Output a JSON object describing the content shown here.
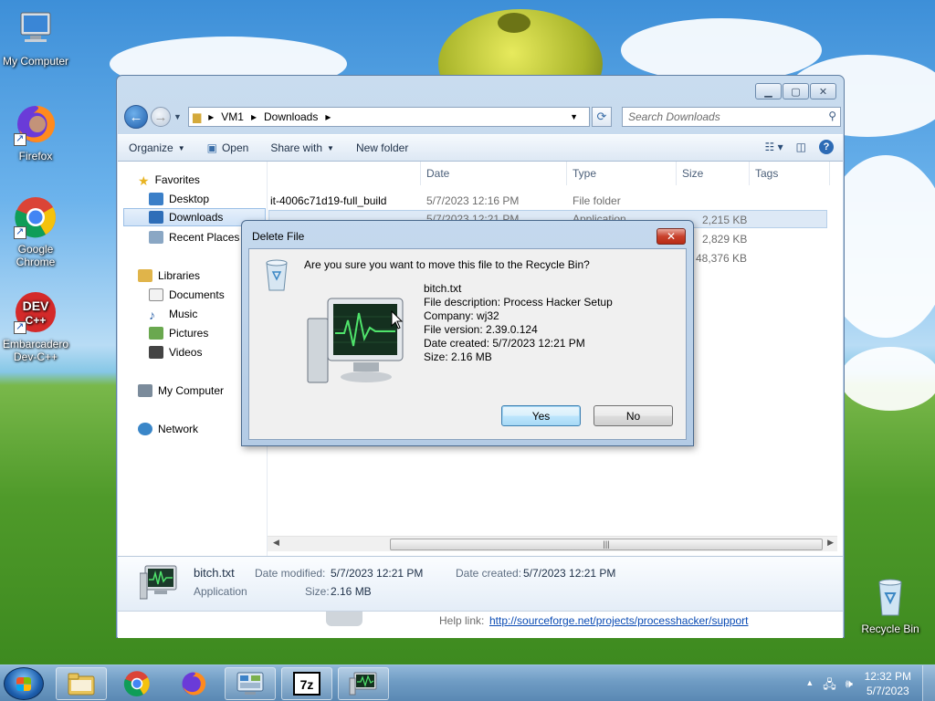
{
  "desktop": {
    "icons": [
      {
        "label": "My Computer"
      },
      {
        "label": "Firefox"
      },
      {
        "label": "Google Chrome"
      },
      {
        "label": "Embarcadero Dev-C++"
      },
      {
        "label": "Recycle Bin"
      }
    ]
  },
  "explorer": {
    "breadcrumb": [
      "VM1",
      "Downloads"
    ],
    "search_placeholder": "Search Downloads",
    "toolbar": {
      "organize": "Organize",
      "open": "Open",
      "share_with": "Share with",
      "new_folder": "New folder"
    },
    "nav": {
      "favorites": "Favorites",
      "desktop": "Desktop",
      "downloads": "Downloads",
      "recent_places": "Recent Places",
      "libraries": "Libraries",
      "documents": "Documents",
      "music": "Music",
      "pictures": "Pictures",
      "videos": "Videos",
      "my_computer": "My Computer",
      "network": "Network"
    },
    "columns": {
      "date": "Date",
      "type": "Type",
      "size": "Size",
      "tags": "Tags"
    },
    "rows": [
      {
        "name": "it-4006c71d19-full_build",
        "date": "5/7/2023 12:16 PM",
        "type": "File folder",
        "size": ""
      },
      {
        "name": "",
        "date": "5/7/2023 12:21 PM",
        "type": "Application",
        "size": "2,215 KB"
      },
      {
        "name": "",
        "date": "",
        "type": "",
        "size": "2,829 KB"
      },
      {
        "name": "",
        "date": "",
        "type": "",
        "size": "48,376 KB"
      }
    ],
    "details": {
      "name": "bitch.txt",
      "type": "Application",
      "modified_label": "Date modified:",
      "modified_value": "5/7/2023 12:21 PM",
      "created_label": "Date created:",
      "created_value": "5/7/2023 12:21 PM",
      "size_label": "Size:",
      "size_value": "2.16 MB"
    },
    "underlay": {
      "help_label": "Help link:",
      "help_link": "http://sourceforge.net/projects/processhacker/support"
    }
  },
  "dialog": {
    "title": "Delete File",
    "question": "Are you sure you want to move this file to the Recycle Bin?",
    "file_name": "bitch.txt",
    "description": "File description: Process Hacker Setup",
    "company": "Company: wj32",
    "version": "File version: 2.39.0.124",
    "created": "Date created: 5/7/2023 12:21 PM",
    "size": "Size: 2.16 MB",
    "yes": "Yes",
    "no": "No"
  },
  "taskbar": {
    "time": "12:32 PM",
    "date": "5/7/2023"
  },
  "colors": {
    "accent": "#3c7fb1",
    "close_red": "#c8412c",
    "taskbar": "#5a88b3"
  }
}
